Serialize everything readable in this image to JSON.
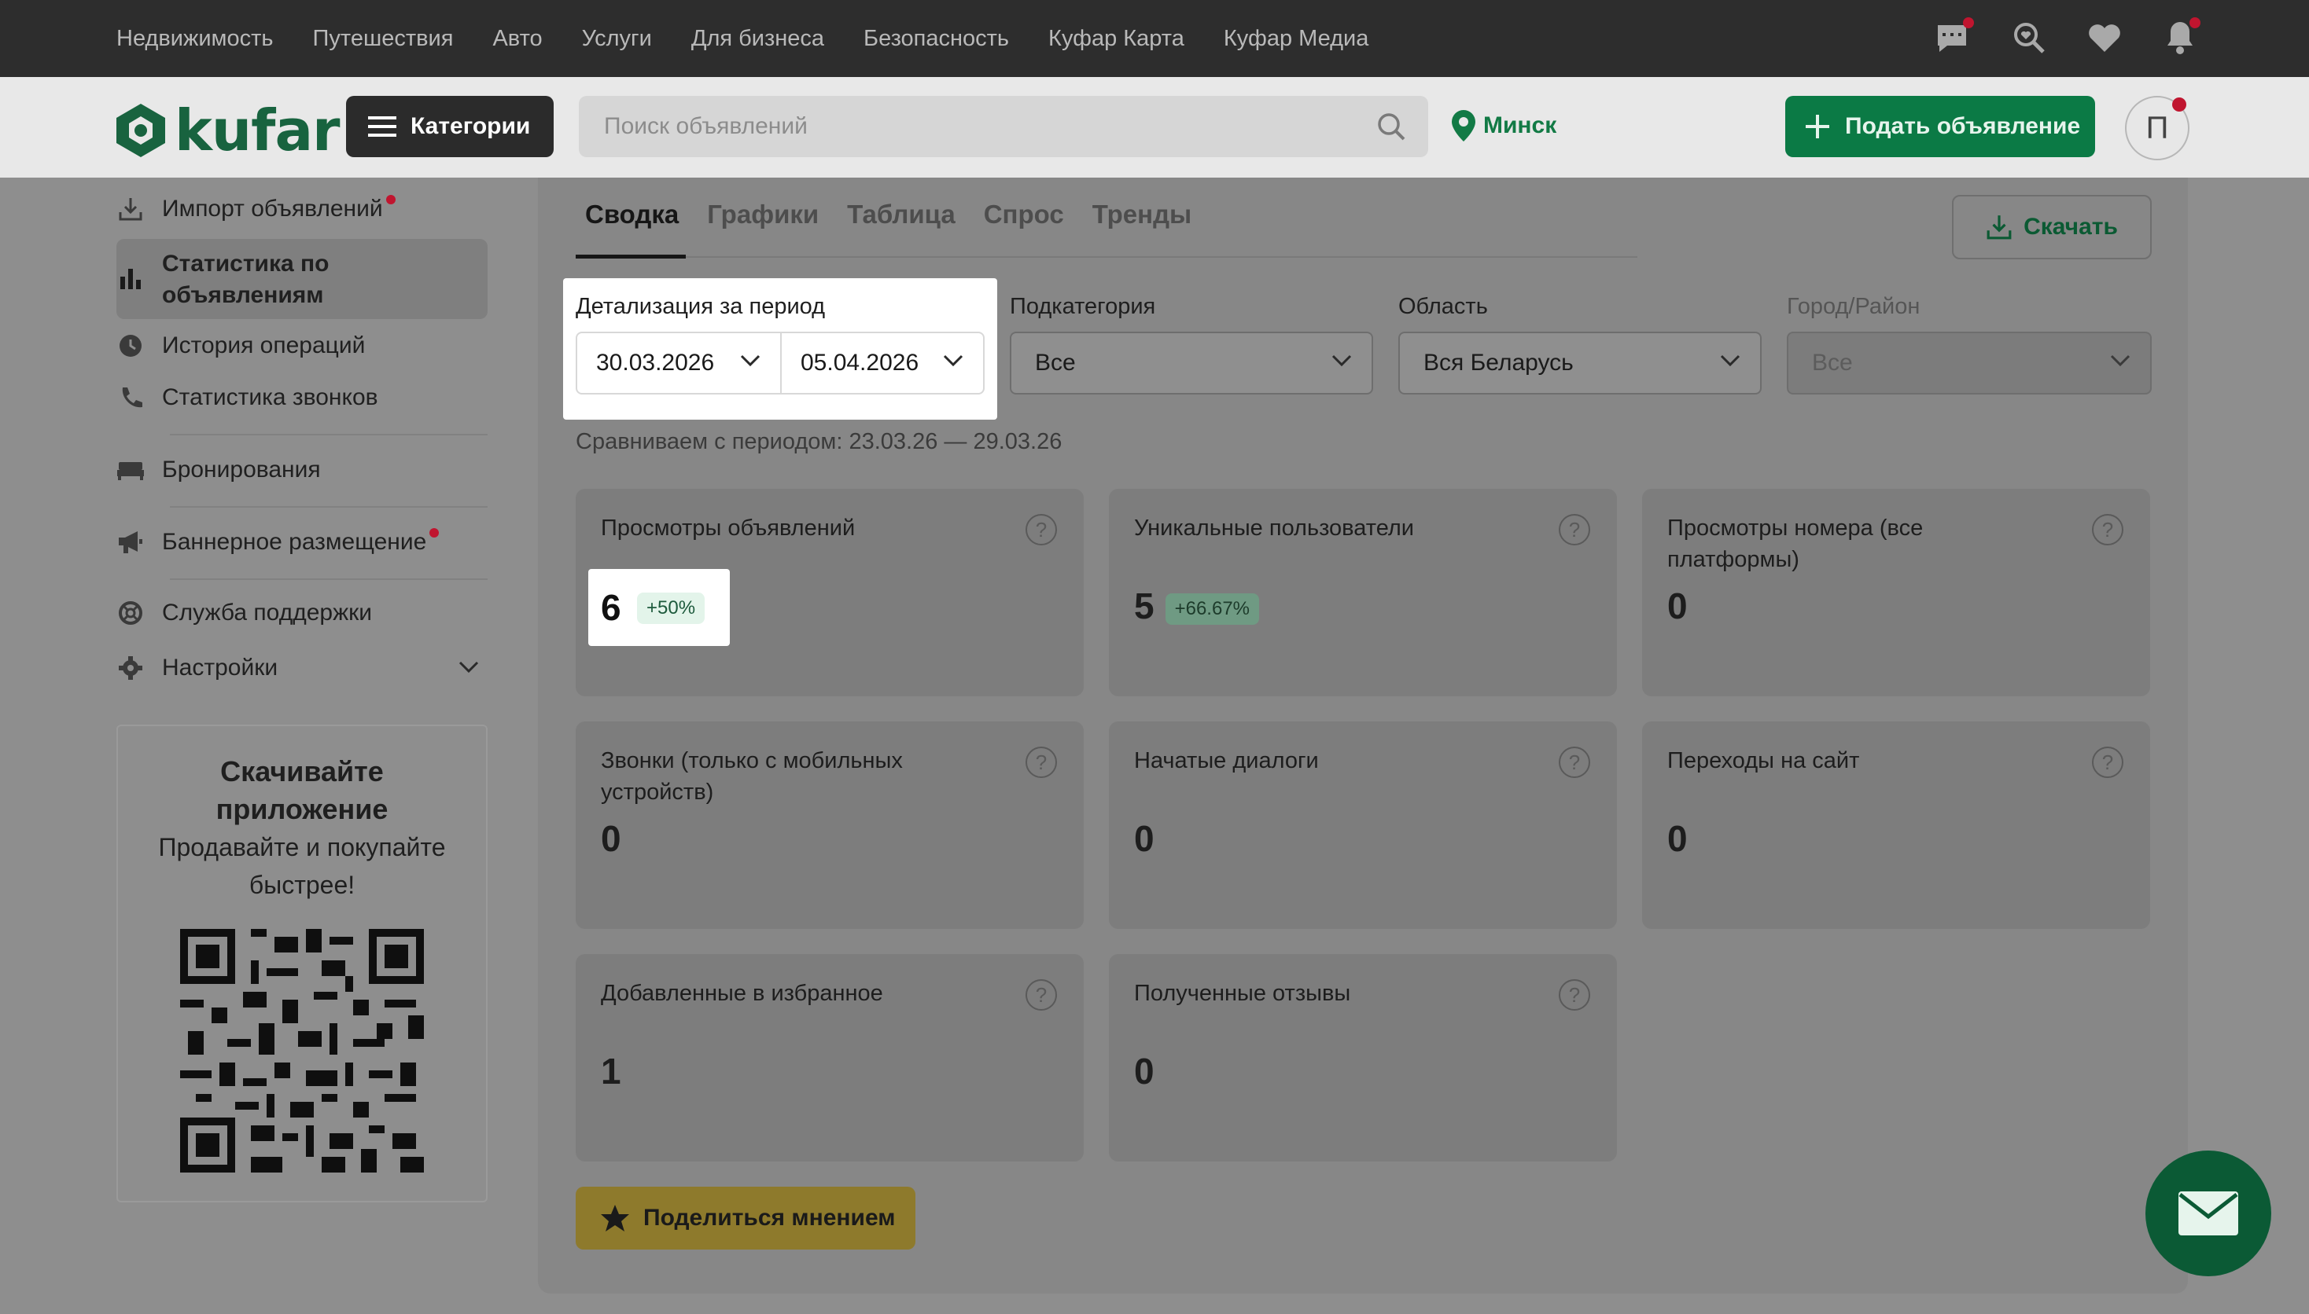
{
  "topnav": {
    "links": [
      "Недвижимость",
      "Путешествия",
      "Авто",
      "Услуги",
      "Для бизнеса",
      "Безопасность",
      "Куфар Карта",
      "Куфар Медиа"
    ]
  },
  "header": {
    "logo": "kufar",
    "categories_label": "Категории",
    "search_placeholder": "Поиск объявлений",
    "city": "Минск",
    "post_ad_label": "Подать объявление",
    "avatar_letter": "П"
  },
  "sidebar": {
    "items": [
      {
        "label": "Импорт объявлений",
        "icon": "download-icon",
        "dot": true
      },
      {
        "label": "Статистика по объявлениям",
        "icon": "bar-chart-icon",
        "active": true
      },
      {
        "label": "История операций",
        "icon": "clock-icon"
      },
      {
        "label": "Статистика звонков",
        "icon": "phone-icon"
      },
      {
        "label": "Бронирования",
        "icon": "bed-icon"
      },
      {
        "label": "Баннерное размещение",
        "icon": "megaphone-icon",
        "dot": true
      },
      {
        "label": "Служба поддержки",
        "icon": "lifebuoy-icon"
      },
      {
        "label": "Настройки",
        "icon": "gear-icon"
      }
    ],
    "promo": {
      "title": "Скачивайте приложение",
      "text": "Продавайте и покупайте быстрее!"
    }
  },
  "tabs": [
    "Сводка",
    "Графики",
    "Таблица",
    "Спрос",
    "Тренды"
  ],
  "download_label": "Скачать",
  "filters": {
    "period_label": "Детализация за период",
    "date_from": "30.03.2026",
    "date_to": "05.04.2026",
    "subcategory_label": "Подкатегория",
    "subcategory_value": "Все",
    "region_label": "Область",
    "region_value": "Вся Беларусь",
    "city_label": "Город/Район",
    "city_value": "Все"
  },
  "compare_text": "Сравниваем с периодом: 23.03.26 — 29.03.26",
  "cards": [
    {
      "title": "Просмотры объявлений",
      "value": "6",
      "change": "+50%"
    },
    {
      "title": "Уникальные пользователи",
      "value": "5",
      "change": "+66.67%"
    },
    {
      "title": "Просмотры номера (все платформы)",
      "value": "0"
    },
    {
      "title": "Звонки (только с мобильных устройств)",
      "value": "0"
    },
    {
      "title": "Начатые диалоги",
      "value": "0"
    },
    {
      "title": "Переходы на сайт",
      "value": "0"
    },
    {
      "title": "Добавленные в избранное",
      "value": "1"
    },
    {
      "title": "Полученные отзывы",
      "value": "0"
    }
  ],
  "share_label": "Поделиться мнением",
  "colors": {
    "brand_green": "#0b7a45",
    "alert_red": "#c0152f",
    "share_yellow": "#f2c94c"
  }
}
